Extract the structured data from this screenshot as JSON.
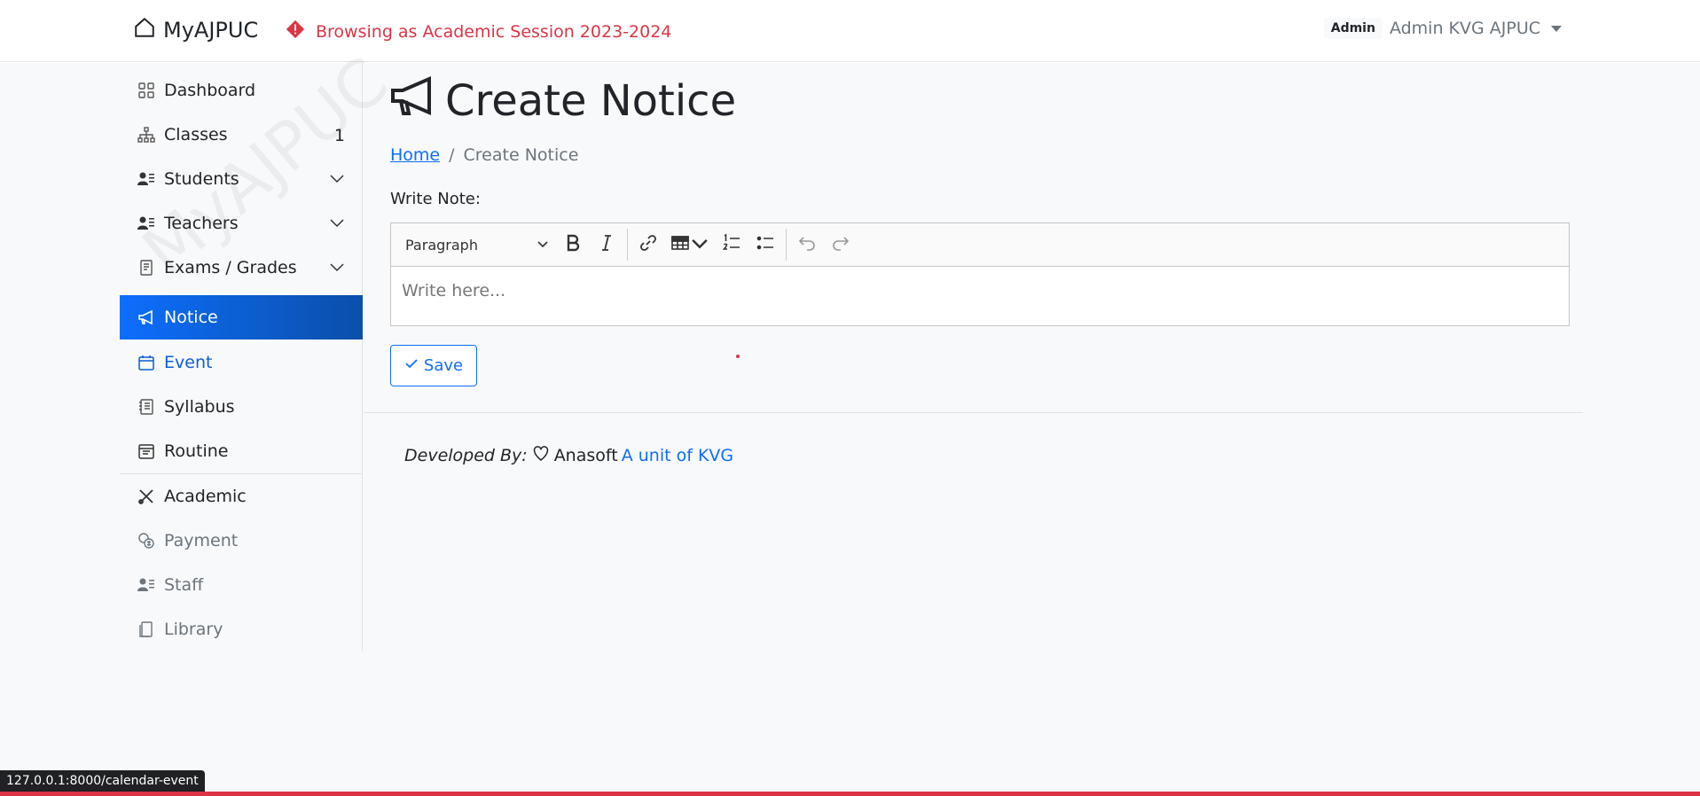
{
  "navbar": {
    "brand": "MyAJPUC",
    "session_notice": "Browsing as Academic Session 2023-2024",
    "user_role": "Admin",
    "user_name": "Admin KVG AJPUC"
  },
  "sidebar": {
    "watermark": "MyAJPUC",
    "items": [
      {
        "label": "Dashboard",
        "icon": "grid-icon"
      },
      {
        "label": "Classes",
        "icon": "diagram-icon",
        "count": "1"
      },
      {
        "label": "Students",
        "icon": "person-lines-icon"
      },
      {
        "label": "Teachers",
        "icon": "person-lines-icon"
      },
      {
        "label": "Exams / Grades",
        "icon": "file-text-icon"
      },
      {
        "label": "Notice",
        "icon": "megaphone-icon"
      },
      {
        "label": "Event",
        "icon": "calendar-icon"
      },
      {
        "label": "Syllabus",
        "icon": "journal-icon"
      },
      {
        "label": "Routine",
        "icon": "calendar-grid-icon"
      },
      {
        "label": "Academic",
        "icon": "tools-icon"
      },
      {
        "label": "Payment",
        "icon": "coin-icon"
      },
      {
        "label": "Staff",
        "icon": "person-lines-icon"
      },
      {
        "label": "Library",
        "icon": "books-icon"
      }
    ]
  },
  "page": {
    "title": "Create Notice",
    "breadcrumb": {
      "home": "Home",
      "separator": "/",
      "current": "Create Notice"
    },
    "write_note_label": "Write Note:",
    "editor": {
      "format_select": "Paragraph",
      "placeholder": "Write here..."
    },
    "save_label": "Save"
  },
  "footer": {
    "developed_by": "Developed By:",
    "company": "Anasoft",
    "unit": "A unit of KVG"
  },
  "status_bar": {
    "url": "127.0.0.1:8000/calendar-event"
  },
  "colors": {
    "primary": "#0d6efd",
    "danger": "#dc3545",
    "sidebar_bg": "#f8f9fa"
  }
}
